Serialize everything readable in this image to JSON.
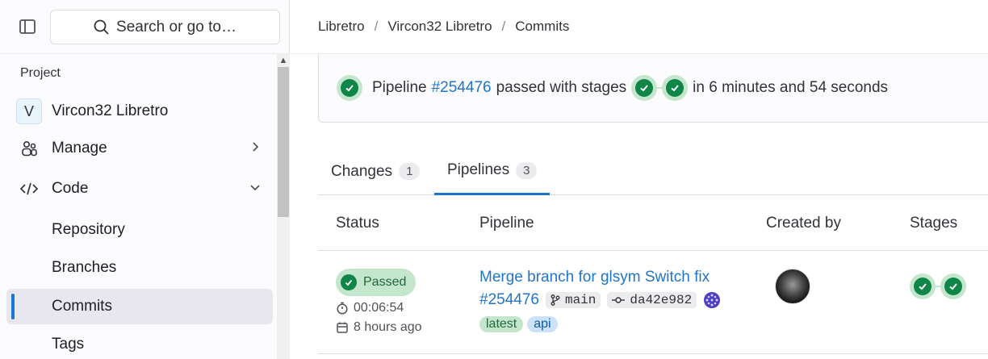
{
  "sidebar": {
    "search_placeholder": "Search or go to…",
    "section": "Project",
    "project_initial": "V",
    "project_name": "Vircon32 Libretro",
    "nav": {
      "manage": "Manage",
      "code": "Code"
    },
    "sub": [
      "Repository",
      "Branches",
      "Commits",
      "Tags"
    ]
  },
  "breadcrumb": [
    "Libretro",
    "Vircon32 Libretro",
    "Commits"
  ],
  "pipeline_summary": {
    "prefix": "Pipeline",
    "id": "#254476",
    "middle": "passed with stages",
    "duration": "in 6 minutes and 54 seconds"
  },
  "tabs": [
    {
      "label": "Changes",
      "count": "1"
    },
    {
      "label": "Pipelines",
      "count": "3"
    }
  ],
  "table": {
    "headers": {
      "status": "Status",
      "pipeline": "Pipeline",
      "created_by": "Created by",
      "stages": "Stages"
    },
    "row": {
      "status": "Passed",
      "duration": "00:06:54",
      "finished": "8 hours ago",
      "title": "Merge branch for glsym Switch fix",
      "pipeline_id": "#254476",
      "branch": "main",
      "commit": "da42e982",
      "labels": [
        "latest",
        "api"
      ]
    }
  },
  "colors": {
    "accent": "#1f75cb",
    "success": "#108548",
    "success_bg": "#c3e6cd"
  }
}
